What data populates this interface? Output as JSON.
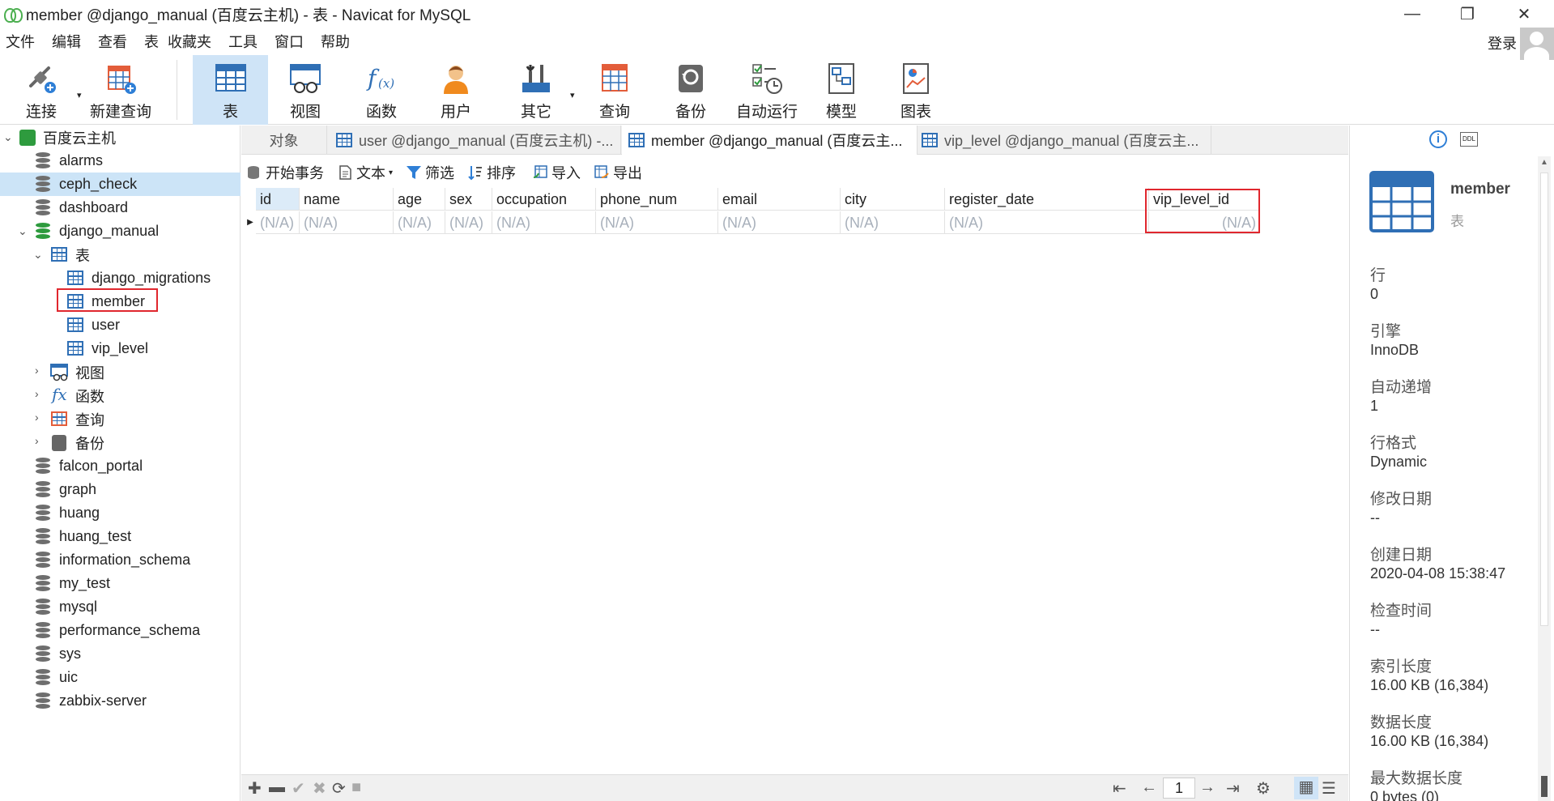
{
  "window": {
    "title": "member @django_manual (百度云主机) - 表 - Navicat for MySQL"
  },
  "menu": [
    "文件",
    "编辑",
    "查看",
    "表",
    "收藏夹",
    "工具",
    "窗口",
    "帮助"
  ],
  "login": "登录",
  "toolbar": {
    "connect": "连接",
    "new_query": "新建查询",
    "table": "表",
    "view": "视图",
    "function": "函数",
    "user": "用户",
    "other": "其它",
    "query": "查询",
    "backup": "备份",
    "auto_run": "自动运行",
    "model": "模型",
    "chart": "图表"
  },
  "tree": {
    "connection": "百度云主机",
    "databases": {
      "alarms": "alarms",
      "ceph_check": "ceph_check",
      "dashboard": "dashboard",
      "django_manual": "django_manual",
      "tables_group": "表",
      "tables": [
        "django_migrations",
        "member",
        "user",
        "vip_level"
      ],
      "views": "视图",
      "functions": "函数",
      "queries": "查询",
      "backups": "备份",
      "rest": [
        "falcon_portal",
        "graph",
        "huang",
        "huang_test",
        "information_schema",
        "my_test",
        "mysql",
        "performance_schema",
        "sys",
        "uic",
        "zabbix-server"
      ]
    }
  },
  "tabs": {
    "objects": "对象",
    "tab1": "user @django_manual (百度云主机) -...",
    "tab2": "member @django_manual (百度云主...",
    "tab3": "vip_level @django_manual (百度云主..."
  },
  "objbar": {
    "begin_tx": "开始事务",
    "text": "文本",
    "filter": "筛选",
    "sort": "排序",
    "import": "导入",
    "export": "导出"
  },
  "grid": {
    "columns": [
      "id",
      "name",
      "age",
      "sex",
      "occupation",
      "phone_num",
      "email",
      "city",
      "register_date",
      "vip_level_id"
    ],
    "row": [
      "(N/A)",
      "(N/A)",
      "(N/A)",
      "(N/A)",
      "(N/A)",
      "(N/A)",
      "(N/A)",
      "(N/A)",
      "(N/A)",
      "(N/A)"
    ]
  },
  "pager": {
    "page": "1"
  },
  "info": {
    "name": "member",
    "type": "表",
    "rows_label": "行",
    "rows": "0",
    "engine_label": "引擎",
    "engine": "InnoDB",
    "autoinc_label": "自动递增",
    "autoinc": "1",
    "rowformat_label": "行格式",
    "rowformat": "Dynamic",
    "modified_label": "修改日期",
    "modified": "--",
    "created_label": "创建日期",
    "created": "2020-04-08 15:38:47",
    "checked_label": "检查时间",
    "checked": "--",
    "index_len_label": "索引长度",
    "index_len": "16.00 KB (16,384)",
    "data_len_label": "数据长度",
    "data_len": "16.00 KB (16,384)",
    "max_data_label": "最大数据长度",
    "max_data": "0 bytes (0)"
  }
}
